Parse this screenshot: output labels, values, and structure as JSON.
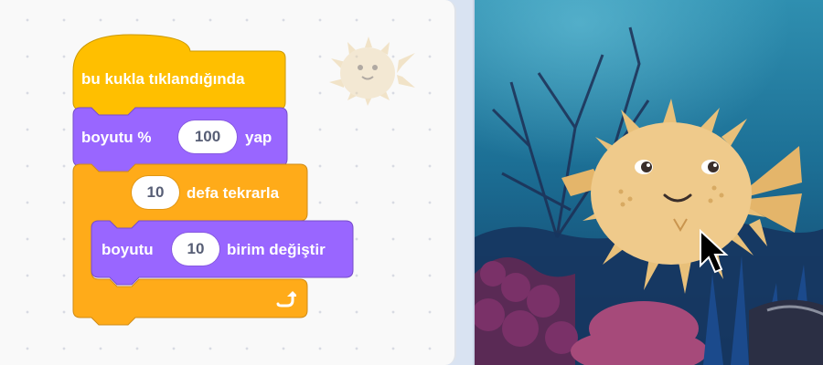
{
  "code": {
    "event_block": {
      "label": "bu kukla tıklandığında"
    },
    "set_size_block": {
      "prefix": "boyutu %",
      "value": "100",
      "suffix": "yap"
    },
    "repeat_block": {
      "count": "10",
      "label": "defa tekrarla"
    },
    "change_size_block": {
      "prefix": "boyutu",
      "value": "10",
      "suffix": "birim değiştir"
    }
  },
  "colors": {
    "event": "#ffbf00",
    "looks": "#9966ff",
    "control": "#ffab19",
    "code_background": "#f9f9f9"
  },
  "icons": {
    "repeat_arrow": "loop-arrow-icon",
    "sprite": "pufferfish-sprite",
    "cursor": "mouse-pointer-icon"
  }
}
